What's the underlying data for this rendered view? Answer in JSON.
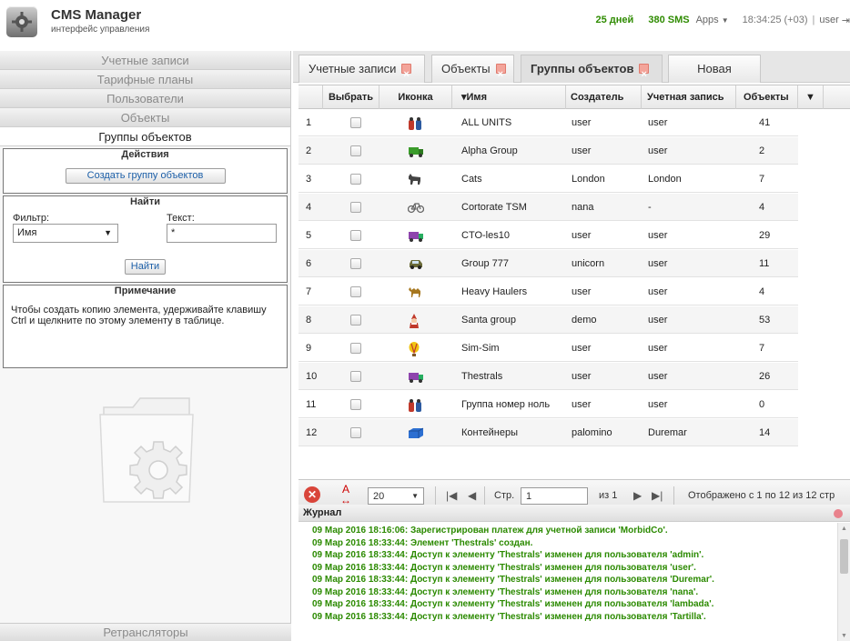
{
  "header": {
    "title": "CMS Manager",
    "subtitle": "интерфейс управления",
    "days": "25 дней",
    "sms": "380 SMS",
    "apps": "Apps",
    "time": "18:34:25 (+03)",
    "separator": "|",
    "user": "user"
  },
  "menu": {
    "items": [
      "Учетные записи",
      "Тарифные планы",
      "Пользователи",
      "Объекты",
      "Группы объектов"
    ],
    "active": "Группы объектов",
    "bottom": "Ретрансляторы"
  },
  "actions": {
    "title": "Действия",
    "create_button": "Создать группу объектов"
  },
  "search": {
    "title": "Найти",
    "filter_label": "Фильтр:",
    "text_label": "Текст:",
    "filter_value": "Имя",
    "text_value": "*",
    "find_button": "Найти"
  },
  "note": {
    "title": "Примечание",
    "text": "Чтобы создать копию элемента, удерживайте клавишу Ctrl и щелкните по этому элементу в таблице."
  },
  "tabs": [
    {
      "label": "Учетные записи",
      "closable": true
    },
    {
      "label": "Объекты",
      "closable": true
    },
    {
      "label": "Группы объектов",
      "closable": true,
      "active": true
    },
    {
      "label": "Новая",
      "closable": false
    }
  ],
  "table": {
    "columns": [
      "Выбрать",
      "Иконка",
      "▾Имя",
      "Создатель",
      "Учетная запись",
      "Объекты"
    ],
    "rows": [
      {
        "n": "1",
        "icon": "people-icon",
        "name": "ALL UNITS",
        "creator": "user",
        "account": "user",
        "objects": "41"
      },
      {
        "n": "2",
        "icon": "green-truck-icon",
        "name": "Alpha Group",
        "creator": "user",
        "account": "user",
        "objects": "2"
      },
      {
        "n": "3",
        "icon": "cat-icon",
        "name": "Cats",
        "creator": "London",
        "account": "London",
        "objects": "7"
      },
      {
        "n": "4",
        "icon": "bicycle-icon",
        "name": "Cortorate TSM",
        "creator": "nana",
        "account": "-",
        "objects": "4"
      },
      {
        "n": "5",
        "icon": "purple-truck-icon",
        "name": "CTO-les10",
        "creator": "user",
        "account": "user",
        "objects": "29"
      },
      {
        "n": "6",
        "icon": "car-icon",
        "name": "Group 777",
        "creator": "unicorn",
        "account": "user",
        "objects": "11"
      },
      {
        "n": "7",
        "icon": "camel-icon",
        "name": "Heavy Haulers",
        "creator": "user",
        "account": "user",
        "objects": "4"
      },
      {
        "n": "8",
        "icon": "santa-icon",
        "name": "Santa group",
        "creator": "demo",
        "account": "user",
        "objects": "53"
      },
      {
        "n": "9",
        "icon": "balloon-icon",
        "name": "Sim-Sim",
        "creator": "user",
        "account": "user",
        "objects": "7"
      },
      {
        "n": "10",
        "icon": "purple-truck-icon",
        "name": "Thestrals",
        "creator": "user",
        "account": "user",
        "objects": "26"
      },
      {
        "n": "11",
        "icon": "people-icon",
        "name": "Группа номер ноль",
        "creator": "user",
        "account": "user",
        "objects": "0"
      },
      {
        "n": "12",
        "icon": "container-icon",
        "name": "Контейнеры",
        "creator": "palomino",
        "account": "Duremar",
        "objects": "14"
      }
    ]
  },
  "pager": {
    "page_size": "20",
    "page_label": "Стр.",
    "page": "1",
    "of": "из 1",
    "shown": "Отображено с 1 по 12 из 12 стр"
  },
  "journal": {
    "title": "Журнал",
    "entries": [
      "09 Мар 2016 18:16:06: Зарегистрирован платеж для учетной записи 'MorbidCo'.",
      "09 Мар 2016 18:33:44: Элемент 'Thestrals' создан.",
      "09 Мар 2016 18:33:44: Доступ к элементу 'Thestrals' изменен для пользователя 'admin'.",
      "09 Мар 2016 18:33:44: Доступ к элементу 'Thestrals' изменен для пользователя 'user'.",
      "09 Мар 2016 18:33:44: Доступ к элементу 'Thestrals' изменен для пользователя 'Duremar'.",
      "09 Мар 2016 18:33:44: Доступ к элементу 'Thestrals' изменен для пользователя 'nana'.",
      "09 Мар 2016 18:33:44: Доступ к элементу 'Thestrals' изменен для пользователя 'lambada'.",
      "09 Мар 2016 18:33:44: Доступ к элементу 'Thestrals' изменен для пользователя 'Tartilla'."
    ]
  },
  "colors": {
    "accent_green": "#2e8b00",
    "link_blue": "#1c5fa8",
    "close_red": "#e07a6d"
  }
}
